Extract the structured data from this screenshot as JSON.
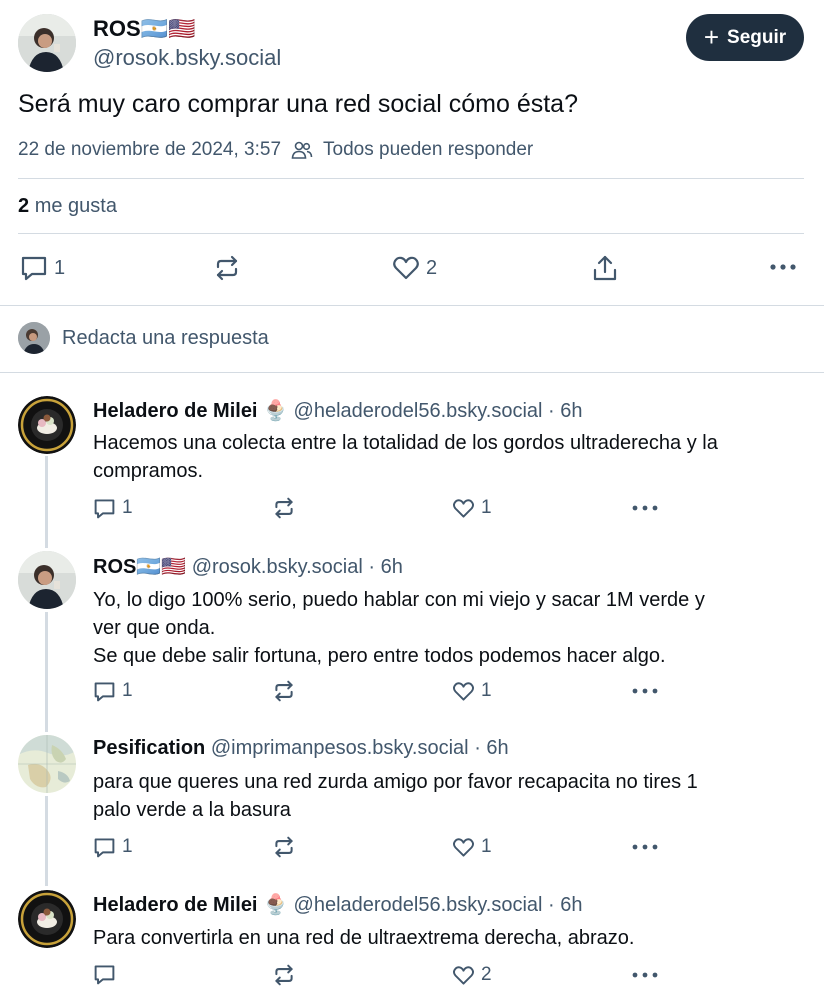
{
  "post": {
    "author_name": "ROS🇦🇷🇺🇸",
    "author_handle": "@rosok.bsky.social",
    "follow_label": "Seguir",
    "text": "Será muy caro comprar una red social cómo ésta?",
    "date": "22 de noviembre de 2024, 3:57",
    "reply_setting": "Todos pueden responder",
    "likes_count": "2",
    "likes_label": "me gusta",
    "reply_count": "1",
    "like_count": "2"
  },
  "compose": {
    "placeholder": "Redacta una respuesta"
  },
  "replies": [
    {
      "name": "Heladero de Milei 🍨",
      "handle": "@heladerodel56.bsky.social",
      "time": "· 6h",
      "lines": [
        "Hacemos una colecta entre la totalidad de los gordos ultraderecha y la",
        "compramos."
      ],
      "reply_count": "1",
      "like_count": "1"
    },
    {
      "name": "ROS🇦🇷🇺🇸",
      "handle": "@rosok.bsky.social",
      "time": "· 6h",
      "lines": [
        "Yo, lo digo 100% serio, puedo hablar con mi viejo y sacar 1M verde y",
        "ver que onda.",
        "Se que debe salir fortuna, pero entre todos podemos hacer algo."
      ],
      "reply_count": "1",
      "like_count": "1"
    },
    {
      "name": "Pesification",
      "handle": "@imprimanpesos.bsky.social",
      "time": "· 6h",
      "lines": [
        "para que queres una red zurda amigo por favor recapacita no tires 1",
        "palo verde a la basura"
      ],
      "reply_count": "1",
      "like_count": "1"
    },
    {
      "name": "Heladero de Milei 🍨",
      "handle": "@heladerodel56.bsky.social",
      "time": "· 6h",
      "lines": [
        "Para convertirla en una red de ultraextrema derecha, abrazo."
      ],
      "reply_count": "",
      "like_count": "2"
    }
  ],
  "icons": {
    "reply": "speech-bubble-icon",
    "repost": "repost-arrows-icon",
    "like": "heart-icon",
    "share": "share-upload-icon",
    "more": "ellipsis-icon",
    "people": "people-icon",
    "plus": "plus-icon"
  },
  "colors": {
    "follow_bg": "#1f2f3f",
    "muted_text": "#42576c",
    "divider": "#d4dbe2"
  }
}
